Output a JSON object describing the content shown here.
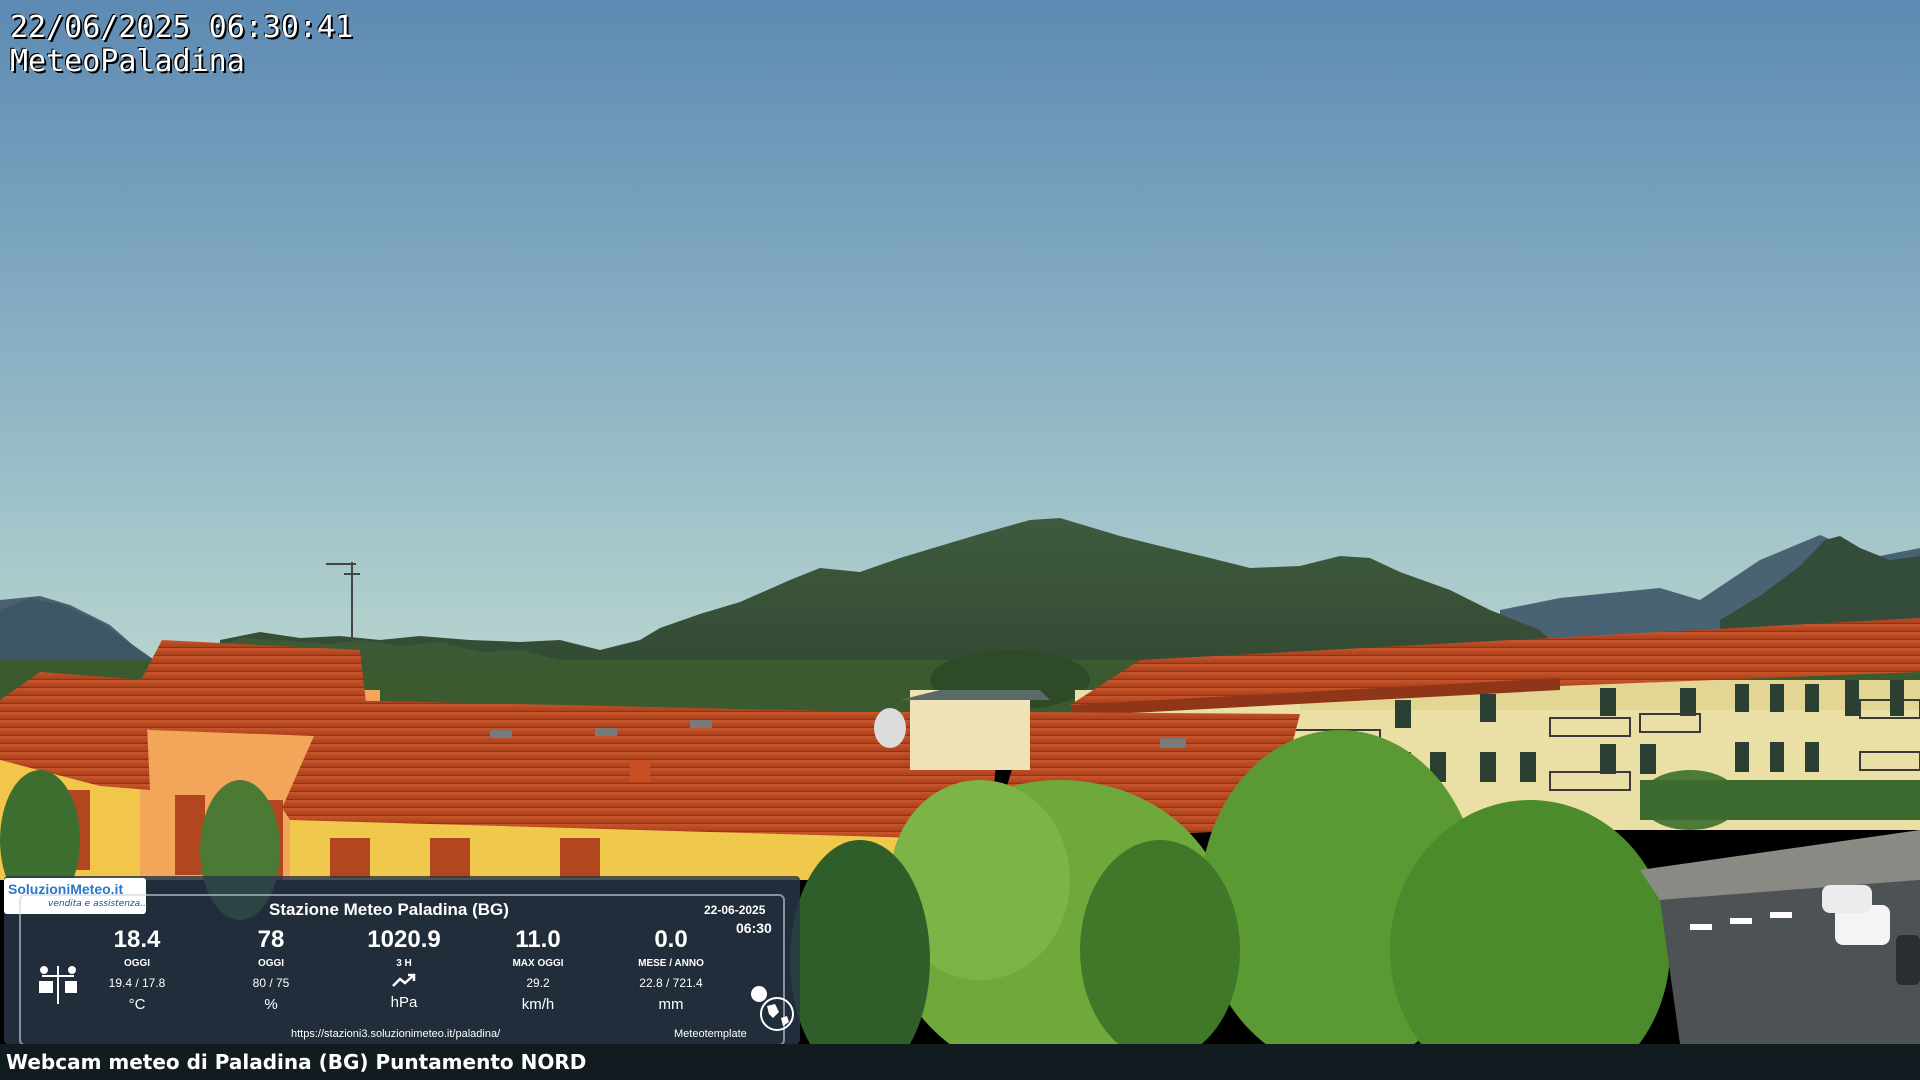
{
  "overlay": {
    "timestamp": "22/06/2025 06:30:41",
    "station": "MeteoPaladina"
  },
  "panel": {
    "logo_text": "SoluzioniMeteo.it",
    "logo_sub": "vendita e assistenza...",
    "title": "Stazione Meteo Paladina (BG)",
    "date": "22-06-2025",
    "time": "06:30",
    "readings": [
      {
        "value": "18.4",
        "label": "OGGI",
        "sub": "19.4 / 17.8",
        "unit": "°C"
      },
      {
        "value": "78",
        "label": "OGGI",
        "sub": "80 / 75",
        "unit": "%"
      },
      {
        "value": "1020.9",
        "label": "3 H",
        "sub": "",
        "unit": "hPa"
      },
      {
        "value": "11.0",
        "label": "MAX OGGI",
        "sub": "29.2",
        "unit": "km/h"
      },
      {
        "value": "0.0",
        "label": "MESE / ANNO",
        "sub": "22.8 / 721.4",
        "unit": "mm"
      }
    ],
    "url": "https://stazioni3.soluzionimeteo.it/paladina/",
    "template": "Meteotemplate",
    "icons": [
      "weather-station-icon",
      "trend-up-icon",
      "globe-icon"
    ]
  },
  "caption": "Webcam meteo di Paladina (BG) Puntamento NORD",
  "colors": {
    "sky_top": "#5f8cb3",
    "sky_bottom": "#b9d6cf",
    "roof": "#b5451f",
    "facade": "#e9dca0",
    "trees": "#6fa83a",
    "panel_bg": "#283748"
  }
}
